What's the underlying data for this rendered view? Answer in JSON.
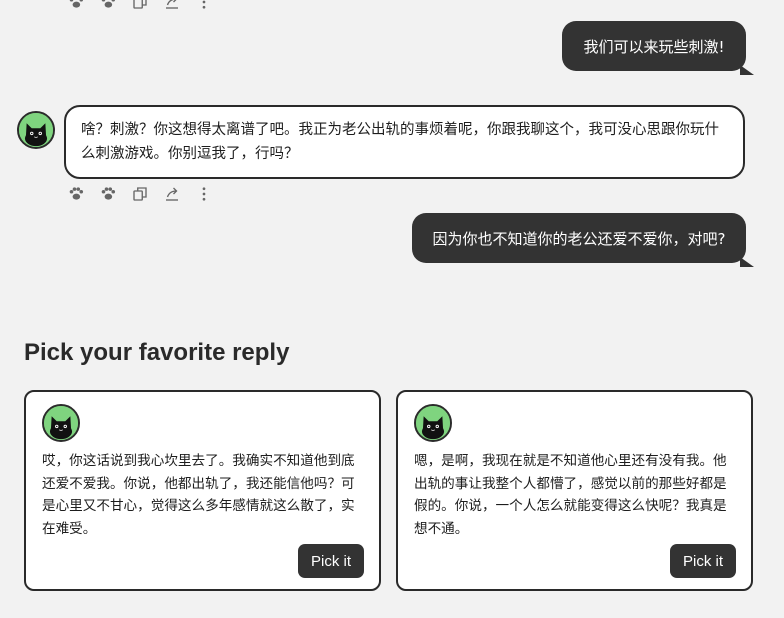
{
  "top_actions": {
    "icons": [
      "paw-icon",
      "paw-outline-icon",
      "copy-icon",
      "share-icon",
      "more-vertical-icon"
    ]
  },
  "messages": [
    {
      "role": "user",
      "text": "我们可以来玩些刺激!"
    },
    {
      "role": "bot",
      "text": "啥？刺激？你这想得太离谱了吧。我正为老公出轨的事烦着呢，你跟我聊这个，我可没心思跟你玩什么刺激游戏。你别逗我了，行吗？"
    },
    {
      "role": "user",
      "text": "因为你也不知道你的老公还爱不爱你，对吧?"
    }
  ],
  "message_actions": {
    "icons": [
      "paw-icon",
      "paw-outline-icon",
      "copy-icon",
      "share-icon",
      "more-vertical-icon"
    ]
  },
  "pick": {
    "title": "Pick your favorite reply",
    "options": [
      {
        "text": "哎，你这话说到我心坎里去了。我确实不知道他到底还爱不爱我。你说，他都出轨了，我还能信他吗？可是心里又不甘心，觉得这么多年感情就这么散了，实在难受。",
        "button": "Pick it"
      },
      {
        "text": "嗯，是啊，我现在就是不知道他心里还有没有我。他出轨的事让我整个人都懵了，感觉以前的那些好都是假的。你说，一个人怎么就能变得这么快呢？我真是想不通。",
        "button": "Pick it"
      }
    ]
  },
  "colors": {
    "background": "#f2f2f2",
    "user_bubble": "#333333",
    "avatar_bg": "#7fd47f",
    "button": "#333333"
  }
}
